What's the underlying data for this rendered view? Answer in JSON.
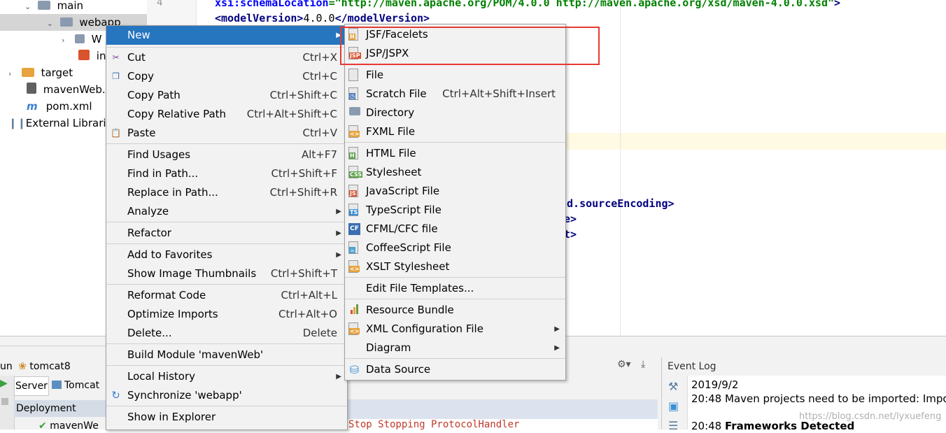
{
  "tree": {
    "items": [
      {
        "label": "main",
        "icon": "folder-icon"
      },
      {
        "label": "webapp",
        "icon": "folder-icon"
      },
      {
        "label": "W",
        "icon": "folder-icon"
      },
      {
        "label": "in",
        "icon": "jsp-file-icon"
      },
      {
        "label": "target",
        "icon": "folder-icon"
      },
      {
        "label": "mavenWeb.i",
        "icon": "module-file-icon"
      },
      {
        "label": "pom.xml",
        "icon": "maven-icon"
      },
      {
        "label": "External Librarie",
        "icon": "libraries-icon"
      }
    ]
  },
  "gutter": {
    "line_number": "4"
  },
  "editor": {
    "line1_attr": "xsi:schemaLocation",
    "line1_eq": "=",
    "line1_value": "\"http://maven.apache.org/POM/4.0.0 http://maven.apache.org/xsd/maven-4.0.0.xsd\"",
    "line1_close": ">",
    "line2_open": "<modelVersion>",
    "line2_text": "4.0.0",
    "line2_close": "</modelVersion>",
    "line3": "ld.sourceEncoding>",
    "line4": "e>",
    "line5": "t>"
  },
  "bottom": {
    "run_label": "un",
    "run_config": "tomcat8",
    "tab_server": "Server",
    "tab_tomcat": "Tomcat",
    "deployment": "Deployment",
    "deploy_item": "mavenWe",
    "console_text": "Stop Stopping ProtocolHandler",
    "event_log_title": "Event Log",
    "log_date": "2019/9/2",
    "log_time1": "20:48",
    "log_msg1": "Maven projects need to be imported: Impo",
    "log_time2": "20:48",
    "log_msg2": "Frameworks Detected",
    "watermark": "https://blog.csdn.net/lyxuefeng"
  },
  "context_menu": {
    "items": [
      {
        "label": "New",
        "shortcut": "",
        "submenu": true,
        "highlighted": true
      },
      {
        "label": "Cut",
        "shortcut": "Ctrl+X",
        "icon": "scissors-icon"
      },
      {
        "label": "Copy",
        "shortcut": "Ctrl+C",
        "icon": "copy-icon"
      },
      {
        "label": "Copy Path",
        "shortcut": "Ctrl+Shift+C"
      },
      {
        "label": "Copy Relative Path",
        "shortcut": "Ctrl+Alt+Shift+C"
      },
      {
        "label": "Paste",
        "shortcut": "Ctrl+V",
        "icon": "paste-icon"
      },
      {
        "label": "Find Usages",
        "shortcut": "Alt+F7"
      },
      {
        "label": "Find in Path...",
        "shortcut": "Ctrl+Shift+F"
      },
      {
        "label": "Replace in Path...",
        "shortcut": "Ctrl+Shift+R"
      },
      {
        "label": "Analyze",
        "shortcut": "",
        "submenu": true
      },
      {
        "label": "Refactor",
        "shortcut": "",
        "submenu": true
      },
      {
        "label": "Add to Favorites",
        "shortcut": "",
        "submenu": true
      },
      {
        "label": "Show Image Thumbnails",
        "shortcut": "Ctrl+Shift+T"
      },
      {
        "label": "Reformat Code",
        "shortcut": "Ctrl+Alt+L"
      },
      {
        "label": "Optimize Imports",
        "shortcut": "Ctrl+Alt+O"
      },
      {
        "label": "Delete...",
        "shortcut": "Delete"
      },
      {
        "label": "Build Module 'mavenWeb'",
        "shortcut": ""
      },
      {
        "label": "Local History",
        "shortcut": "",
        "submenu": true
      },
      {
        "label": "Synchronize 'webapp'",
        "shortcut": "",
        "icon": "sync-icon"
      },
      {
        "label": "Show in Explorer",
        "shortcut": ""
      }
    ]
  },
  "new_submenu": {
    "items": [
      {
        "label": "JSF/Facelets",
        "icon": "jsf-file-icon",
        "tag": "H",
        "color": "#e8a33d"
      },
      {
        "label": "JSP/JSPX",
        "icon": "jsp-file-icon",
        "tag": "JSP",
        "color": "#d9532c"
      },
      {
        "label": "File",
        "icon": "file-icon",
        "tag": "",
        "color": "#9a9a9a"
      },
      {
        "label": "Scratch File",
        "shortcut": "Ctrl+Alt+Shift+Insert",
        "icon": "scratch-file-icon",
        "tag": "",
        "color": "#4a7fc0"
      },
      {
        "label": "Directory",
        "icon": "directory-icon",
        "tag": "",
        "color": "#8a9bb0"
      },
      {
        "label": "FXML File",
        "icon": "fxml-file-icon",
        "tag": "<>",
        "color": "#e8a33d"
      },
      {
        "label": "HTML File",
        "icon": "html-file-icon",
        "tag": "H",
        "color": "#5aa04a"
      },
      {
        "label": "Stylesheet",
        "icon": "css-file-icon",
        "tag": "CSS",
        "color": "#5aa04a"
      },
      {
        "label": "JavaScript File",
        "icon": "js-file-icon",
        "tag": "JS",
        "color": "#d9532c"
      },
      {
        "label": "TypeScript File",
        "icon": "ts-file-icon",
        "tag": "TS",
        "color": "#3a8fd6"
      },
      {
        "label": "CFML/CFC file",
        "icon": "cfml-file-icon",
        "tag": "CF",
        "color": "#3a6fb0"
      },
      {
        "label": "CoffeeScript File",
        "icon": "coffeescript-file-icon",
        "tag": "",
        "color": "#4aa0d6"
      },
      {
        "label": "XSLT Stylesheet",
        "icon": "xslt-file-icon",
        "tag": "<>",
        "color": "#e8a33d"
      },
      {
        "label": "Edit File Templates...",
        "icon": ""
      },
      {
        "label": "Resource Bundle",
        "icon": "resource-bundle-icon",
        "tag": "",
        "color": "#6a9a3a"
      },
      {
        "label": "XML Configuration File",
        "icon": "xml-config-file-icon",
        "tag": "<>",
        "color": "#e8a33d",
        "submenu": true
      },
      {
        "label": "Diagram",
        "icon": "",
        "submenu": true
      },
      {
        "label": "Data Source",
        "icon": "data-source-icon",
        "tag": "",
        "color": "#3a8fd6"
      }
    ]
  },
  "colors": {
    "highlight": "#2675bf",
    "annotation_box": "#e53935"
  }
}
